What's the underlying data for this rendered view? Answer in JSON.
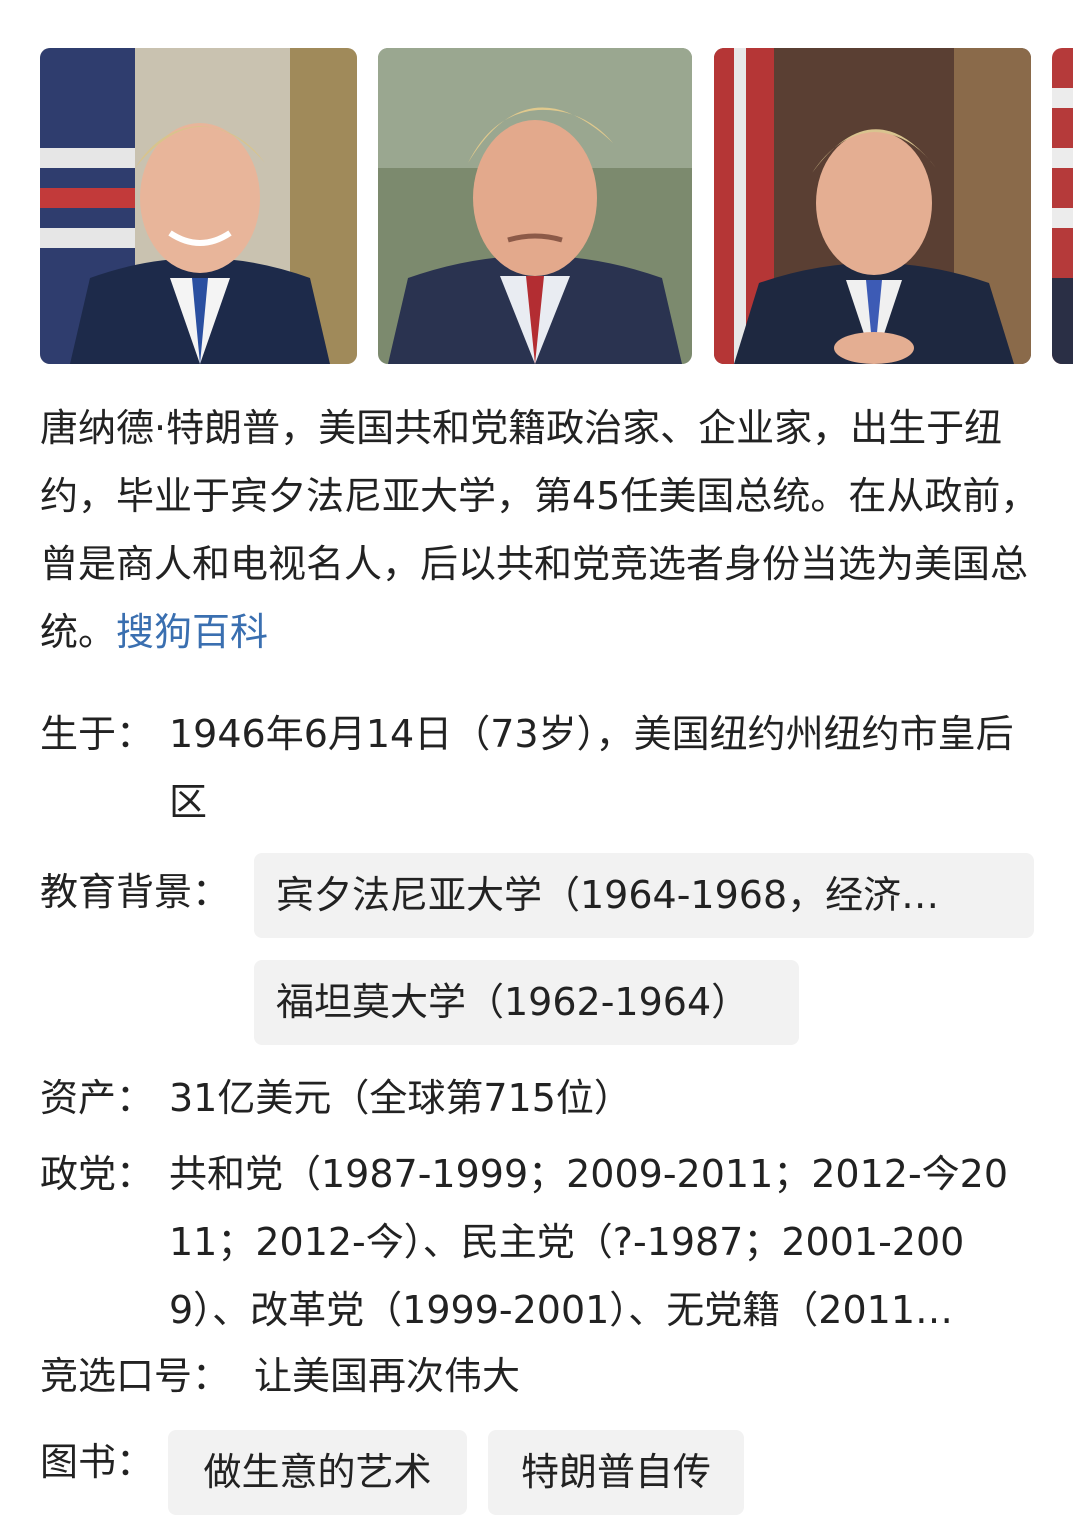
{
  "images": [
    {
      "name": "portrait-photo-1",
      "background": "#3b4a73"
    },
    {
      "name": "portrait-photo-2",
      "background": "#5e6a50"
    },
    {
      "name": "portrait-photo-3",
      "background": "#4a3a32"
    },
    {
      "name": "portrait-photo-4",
      "background": "#b53a3a"
    }
  ],
  "summary": {
    "text": "唐纳德·特朗普，美国共和党籍政治家、企业家，出生于纽约，毕业于宾夕法尼亚大学，第45任美国总统。在从政前，曾是商人和电视名人，后以共和党竞选者身份当选为美国总统。",
    "source_link": "搜狗百科"
  },
  "facts": {
    "birth": {
      "label": "生于：",
      "value": "1946年6月14日（73岁），美国纽约州纽约市皇后区"
    },
    "education": {
      "label": "教育背景：",
      "items": [
        "宾夕法尼亚大学（1964-1968，经济…",
        "福坦莫大学（1962-1964）"
      ]
    },
    "assets": {
      "label": "资产：",
      "value": "31亿美元（全球第715位）"
    },
    "party": {
      "label": "政党：",
      "value": "共和党（1987-1999；2009-2011；2012-今2011；2012-今）、民主党（?-1987；2001-2009）、改革党（1999-2001）、无党籍（2011…"
    },
    "slogan": {
      "label": "竞选口号：",
      "value": "让美国再次伟大"
    },
    "books": {
      "label": "图书：",
      "items": [
        "做生意的艺术",
        "特朗普自传"
      ]
    }
  },
  "colors": {
    "text": "#222222",
    "link": "#3a6fb0",
    "chip_background": "#f2f2f2"
  }
}
